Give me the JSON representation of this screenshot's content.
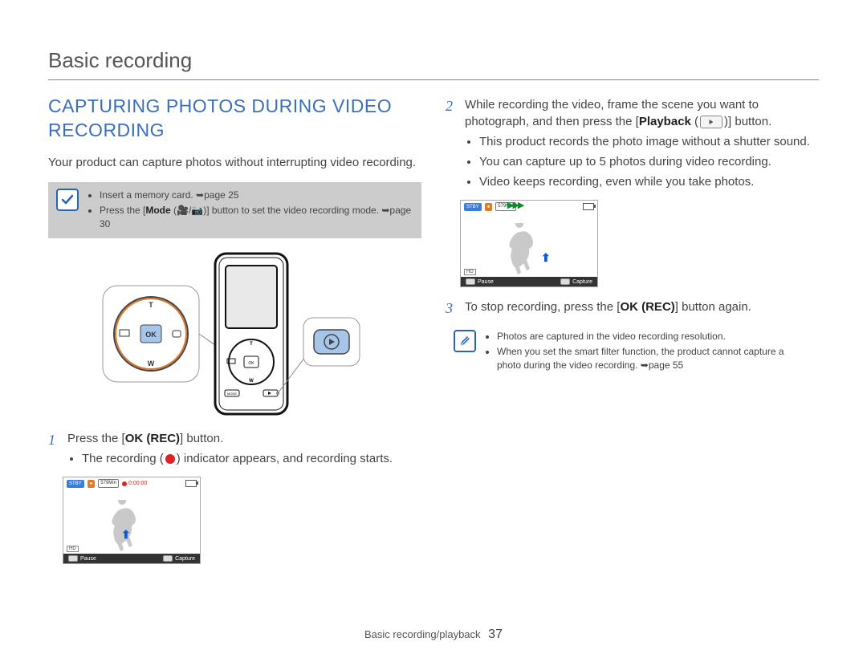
{
  "page": {
    "header": "Basic recording",
    "footer_label": "Basic recording/playback",
    "number": "37"
  },
  "section": {
    "heading": "CAPTURING PHOTOS DURING VIDEO RECORDING",
    "intro": "Your product can capture photos without interrupting video recording."
  },
  "prereq_note": {
    "item1": "Insert a memory card. ➥page 25",
    "item2_a": "Press the [",
    "item2_b": "Mode",
    "item2_c": " (🎥/📷)] button to set the video recording mode. ➥page 30"
  },
  "step1": {
    "num": "1",
    "line_a": "Press the [",
    "line_b": "OK (REC)",
    "line_c": "] button.",
    "bullet_a": "The recording (",
    "bullet_b": ") indicator appears, and recording starts."
  },
  "lcd1": {
    "stby": "STBY",
    "min": "579Min",
    "time": "0:00:00",
    "hd": "HD",
    "pause": "Pause",
    "capture": "Capture"
  },
  "step2": {
    "num": "2",
    "line_a": "While recording the video, frame the scene you want to photograph, and then press the [",
    "line_b": "Playback",
    "line_c": " (",
    "line_d": ")] button.",
    "bullet1": "This product records the photo image without a shutter sound.",
    "bullet2": "You can capture up to 5 photos during video recording.",
    "bullet3": "Video keeps recording, even while you take photos."
  },
  "lcd2": {
    "stby": "STBY",
    "min": "579Min",
    "hd": "HD",
    "pause": "Pause",
    "capture": "Capture"
  },
  "step3": {
    "num": "3",
    "line_a": "To stop recording, press the [",
    "line_b": "OK (REC)",
    "line_c": "] button again."
  },
  "end_note": {
    "item1": "Photos are captured in the video recording resolution.",
    "item2": "When you set the smart filter function, the product cannot capture a photo during the video recording. ➥page 55"
  }
}
